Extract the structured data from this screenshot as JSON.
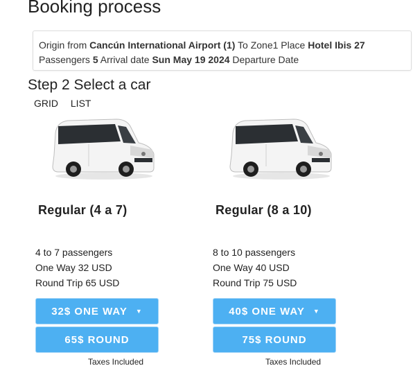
{
  "page_title": "Booking process",
  "summary": {
    "origin_label": "Origin from",
    "origin_value": "Cancún International Airport (1)",
    "to_label": "To Zone1 Place",
    "place_value": "Hotel Ibis 27",
    "passengers_label": "Passengers",
    "passengers_value": "5",
    "arrival_label": "Arrival date",
    "arrival_value": "Sun May 19 2024",
    "departure_label": "Departure Date"
  },
  "step_title": "Step 2 Select a car",
  "view_toggle": {
    "grid": "GRID",
    "list": "LIST"
  },
  "cars": [
    {
      "name": "Regular (4 a 7)",
      "passengers": "4 to 7 passengers",
      "one_way": "One Way 32 USD",
      "round_trip": "Round Trip 65 USD",
      "one_way_button": "32$ ONE WAY",
      "round_button": "65$ ROUND",
      "taxes": "Taxes Included"
    },
    {
      "name": "Regular (8 a 10)",
      "passengers": "8 to 10 passengers",
      "one_way": "One Way 40 USD",
      "round_trip": "Round Trip 75 USD",
      "one_way_button": "40$ ONE WAY",
      "round_button": "75$ ROUND",
      "taxes": "Taxes Included"
    }
  ],
  "icons": {
    "dropdown": "caret-down-icon",
    "vehicle": "van-image"
  },
  "colors": {
    "button": "#4db0f2",
    "button_text": "#ffffff"
  }
}
